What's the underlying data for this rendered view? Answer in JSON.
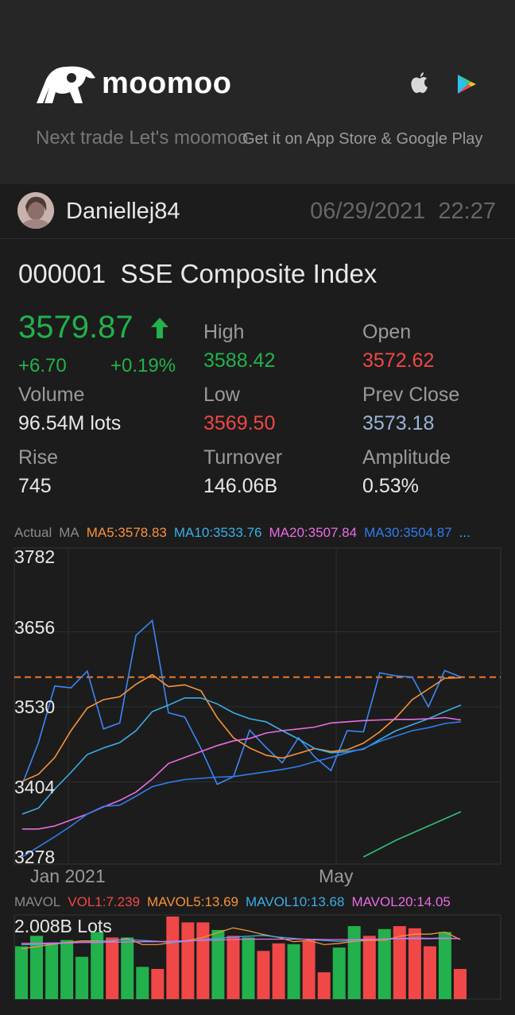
{
  "banner": {
    "brand": "moomoo",
    "slogan": "Next trade Let's moomoo",
    "store_text": "Get it on App Store & Google Play",
    "icons": [
      "apple-icon",
      "google-play-icon"
    ]
  },
  "post": {
    "username": "Daniellej84",
    "date": "06/29/2021",
    "time": "22:27"
  },
  "stock": {
    "code": "000001",
    "name": "SSE Composite Index",
    "price": "3579.87",
    "change": "+6.70",
    "change_pct": "+0.19%",
    "stats": {
      "high_label": "High",
      "high": "3588.42",
      "open_label": "Open",
      "open": "3572.62",
      "volume_label": "Volume",
      "volume": "96.54M lots",
      "low_label": "Low",
      "low": "3569.50",
      "prev_close_label": "Prev Close",
      "prev_close": "3573.18",
      "rise_label": "Rise",
      "rise": "745",
      "turnover_label": "Turnover",
      "turnover": "146.06B",
      "amplitude_label": "Amplitude",
      "amplitude": "0.53%"
    }
  },
  "colors": {
    "up": "#22b14c",
    "down": "#f04747",
    "ma5": "#f7923a",
    "ma10": "#3aaee8",
    "ma20": "#e96ce3",
    "ma30": "#2f7cf0",
    "actual": "#3b87f5"
  },
  "chart_data": [
    {
      "type": "line",
      "title": "",
      "legend": [
        "Actual",
        "MA",
        "MA5:3578.83",
        "MA10:3533.76",
        "MA20:3507.84",
        "MA30:3504.87",
        "..."
      ],
      "ylim": [
        3278,
        3782
      ],
      "y_ticks": [
        "3782",
        "3656",
        "3530",
        "3404",
        "3278"
      ],
      "x_ticks": [
        "Jan 2021",
        "May"
      ],
      "current_price_line": 3579.87,
      "series": [
        {
          "name": "Actual",
          "values": [
            3400,
            3470,
            3565,
            3562,
            3590,
            3493,
            3503,
            3650,
            3675,
            3520,
            3513,
            3460,
            3400,
            3413,
            3491,
            3462,
            3436,
            3478,
            3446,
            3423,
            3490,
            3488,
            3587,
            3582,
            3580,
            3530,
            3591,
            3580
          ]
        },
        {
          "name": "MA5",
          "values": [
            3405,
            3417,
            3445,
            3490,
            3528,
            3542,
            3547,
            3568,
            3584,
            3564,
            3567,
            3557,
            3512,
            3478,
            3461,
            3449,
            3444,
            3452,
            3460,
            3455,
            3458,
            3469,
            3488,
            3512,
            3542,
            3560,
            3578,
            3579
          ]
        },
        {
          "name": "MA10",
          "values": [
            3350,
            3360,
            3392,
            3420,
            3450,
            3461,
            3470,
            3490,
            3522,
            3533,
            3545,
            3545,
            3535,
            3520,
            3510,
            3505,
            3490,
            3476,
            3460,
            3453,
            3455,
            3459,
            3475,
            3490,
            3500,
            3510,
            3522,
            3533
          ]
        },
        {
          "name": "MA20",
          "values": [
            3325,
            3325,
            3330,
            3340,
            3350,
            3362,
            3373,
            3387,
            3409,
            3435,
            3445,
            3455,
            3465,
            3473,
            3477,
            3486,
            3490,
            3493,
            3496,
            3503,
            3505,
            3507,
            3508,
            3509,
            3509,
            3510,
            3512,
            3508
          ]
        },
        {
          "name": "MA30",
          "values": [
            3278,
            3295,
            3312,
            3330,
            3350,
            3363,
            3365,
            3380,
            3396,
            3403,
            3408,
            3410,
            3412,
            3413,
            3417,
            3421,
            3425,
            3430,
            3438,
            3445,
            3453,
            3460,
            3472,
            3481,
            3490,
            3495,
            3502,
            3505
          ]
        },
        {
          "name": "MA60",
          "values": [
            null,
            null,
            null,
            null,
            null,
            null,
            null,
            null,
            null,
            null,
            null,
            null,
            null,
            null,
            null,
            null,
            null,
            null,
            null,
            null,
            null,
            3278,
            3292,
            3306,
            3318,
            3330,
            3342,
            3354
          ]
        }
      ]
    },
    {
      "type": "bar",
      "title": "",
      "legend": [
        "MAVOL",
        "VOL1:7.239",
        "MAVOL5:13.69",
        "MAVOL10:13.68",
        "MAVOL20:14.05"
      ],
      "ylabel": "2.008B Lots",
      "ylim": [
        0,
        2.008
      ],
      "bars": [
        {
          "value": 1.26,
          "dir": "up"
        },
        {
          "value": 1.51,
          "dir": "up"
        },
        {
          "value": 1.31,
          "dir": "up"
        },
        {
          "value": 1.41,
          "dir": "up"
        },
        {
          "value": 1.01,
          "dir": "up"
        },
        {
          "value": 1.6,
          "dir": "up"
        },
        {
          "value": 1.47,
          "dir": "down"
        },
        {
          "value": 1.47,
          "dir": "up"
        },
        {
          "value": 0.77,
          "dir": "up"
        },
        {
          "value": 0.72,
          "dir": "down"
        },
        {
          "value": 1.97,
          "dir": "down"
        },
        {
          "value": 1.83,
          "dir": "down"
        },
        {
          "value": 1.83,
          "dir": "down"
        },
        {
          "value": 1.65,
          "dir": "up"
        },
        {
          "value": 1.51,
          "dir": "down"
        },
        {
          "value": 1.47,
          "dir": "up"
        },
        {
          "value": 1.15,
          "dir": "down"
        },
        {
          "value": 1.33,
          "dir": "down"
        },
        {
          "value": 1.31,
          "dir": "up"
        },
        {
          "value": 1.4,
          "dir": "down"
        },
        {
          "value": 0.64,
          "dir": "down"
        },
        {
          "value": 1.23,
          "dir": "up"
        },
        {
          "value": 1.74,
          "dir": "up"
        },
        {
          "value": 1.51,
          "dir": "down"
        },
        {
          "value": 1.67,
          "dir": "up"
        },
        {
          "value": 1.74,
          "dir": "down"
        },
        {
          "value": 1.69,
          "dir": "down"
        },
        {
          "value": 1.26,
          "dir": "down"
        },
        {
          "value": 1.6,
          "dir": "up"
        },
        {
          "value": 0.72,
          "dir": "down"
        }
      ],
      "series": [
        {
          "name": "MAVOL5",
          "values": [
            1.2,
            1.25,
            1.3,
            1.35,
            1.39,
            1.39,
            1.38,
            1.45,
            1.3,
            1.3,
            1.35,
            1.4,
            1.47,
            1.59,
            1.7,
            1.63,
            1.54,
            1.47,
            1.37,
            1.4,
            1.3,
            1.33,
            1.38,
            1.4,
            1.4,
            1.5,
            1.55,
            1.55,
            1.6,
            1.42
          ]
        },
        {
          "name": "MAVOL10",
          "values": [
            1.3,
            1.3,
            1.32,
            1.34,
            1.36,
            1.37,
            1.4,
            1.42,
            1.4,
            1.38,
            1.35,
            1.38,
            1.42,
            1.45,
            1.48,
            1.5,
            1.52,
            1.48,
            1.45,
            1.42,
            1.4,
            1.38,
            1.4,
            1.42,
            1.44,
            1.45,
            1.46,
            1.45,
            1.46,
            1.44
          ]
        },
        {
          "name": "MAVOL20",
          "values": [
            1.33,
            1.33,
            1.34,
            1.34,
            1.35,
            1.35,
            1.36,
            1.36,
            1.37,
            1.37,
            1.38,
            1.39,
            1.4,
            1.41,
            1.42,
            1.43,
            1.43,
            1.43,
            1.43,
            1.43,
            1.42,
            1.42,
            1.42,
            1.43,
            1.43,
            1.44,
            1.44,
            1.44,
            1.45,
            1.44
          ]
        }
      ]
    }
  ]
}
